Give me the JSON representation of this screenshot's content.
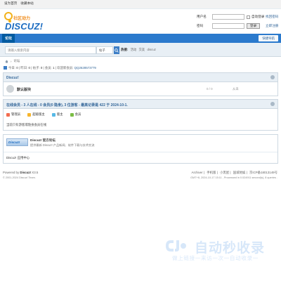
{
  "topbar": {
    "set_home": "设为首页",
    "favorite": "收藏本站"
  },
  "logo": {
    "cn": "社区动力",
    "en": "DISCUZ!"
  },
  "login": {
    "username_label": "用户名",
    "password_label": "密码",
    "remember": "自动登录",
    "login_button": "登录",
    "find_password": "找回密码",
    "register": "立即注册"
  },
  "nav": {
    "tab": "论坛",
    "quick": "快捷导航"
  },
  "search": {
    "placeholder": "请输入搜索内容",
    "type": "帖子",
    "hot_label": "热搜:",
    "hot": [
      "活动",
      "交友",
      "discuz"
    ]
  },
  "breadcrumb": {
    "sep": "›",
    "item": "论坛"
  },
  "stats": {
    "today_label": "今日:",
    "today": "0",
    "yesterday_label": "昨日:",
    "yesterday": "0",
    "posts_label": "帖子:",
    "posts": "0",
    "members_label": "会员:",
    "members": "1",
    "welcome": "欢迎新会员:",
    "newest": "QQ2628573779"
  },
  "forum_box": {
    "title": "Discuz!",
    "forum_name": "默认版块",
    "count": "0 / 0",
    "last": "从未"
  },
  "online": {
    "title": "在线会员 - 3 人在线 - 0 会员(0 隐身), 3 位游客 - 最高记录是 422 于 2024-10-1.",
    "legend": [
      "管理员",
      "超级版主",
      "版主",
      "会员"
    ],
    "legend_colors": [
      "#f26c4f",
      "#f7b52c",
      "#58b9e6",
      "#7bbd45"
    ],
    "note": "当前只有游客或隐身会员在线"
  },
  "links": {
    "badge": "Discuz!",
    "title": "Discuz! 官方论坛",
    "desc": "提供最新 Discuz! 产品新闻、软件下载与技术交流",
    "link2": "Discuz! 应用中心"
  },
  "footer": {
    "powered": "Powered by",
    "product": "Discuz!",
    "version": "X3.5",
    "copyright": "© 2001-2024 Discuz! Team.",
    "right_links": [
      "Archiver",
      "手机版",
      "小黑屋",
      "国城地娱",
      "京ICP备18013149号"
    ],
    "gmt": "GMT+8, 2024-10-17 15:11 , Processed in 0.024911 second(s), 8 queries ."
  },
  "watermark": {
    "title": "自动秒收录",
    "slogan": "做上链接一来访一次一自动收录一"
  }
}
